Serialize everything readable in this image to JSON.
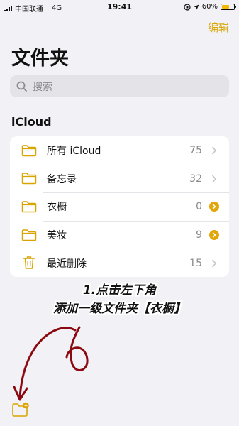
{
  "status_bar": {
    "carrier": "中国联通",
    "network": "4G",
    "time": "19:41",
    "battery": "60%",
    "battery_level": 0.6
  },
  "header": {
    "edit_label": "编辑",
    "title": "文件夹"
  },
  "search": {
    "placeholder": "搜索"
  },
  "section": {
    "title": "iCloud"
  },
  "folders": [
    {
      "label": "所有 iCloud",
      "count": "75",
      "icon": "folder-icon",
      "accessory": "chevron-right-icon"
    },
    {
      "label": "备忘录",
      "count": "32",
      "icon": "folder-icon",
      "accessory": "chevron-right-icon"
    },
    {
      "label": "衣橱",
      "count": "0",
      "icon": "folder-icon",
      "accessory": "chevron-right-badge-icon"
    },
    {
      "label": "美妆",
      "count": "9",
      "icon": "folder-icon",
      "accessory": "chevron-right-badge-icon"
    },
    {
      "label": "最近删除",
      "count": "15",
      "icon": "trash-icon",
      "accessory": "chevron-right-icon"
    }
  ],
  "annotation": {
    "line1": "1.点击左下角",
    "line2": "添加一级文件夹【衣橱】"
  },
  "toolbar": {
    "new_folder_icon": "new-folder-icon"
  },
  "colors": {
    "accent": "#e0a60a",
    "annotation_arrow": "#8b0a12",
    "background": "#f2f2f6"
  }
}
